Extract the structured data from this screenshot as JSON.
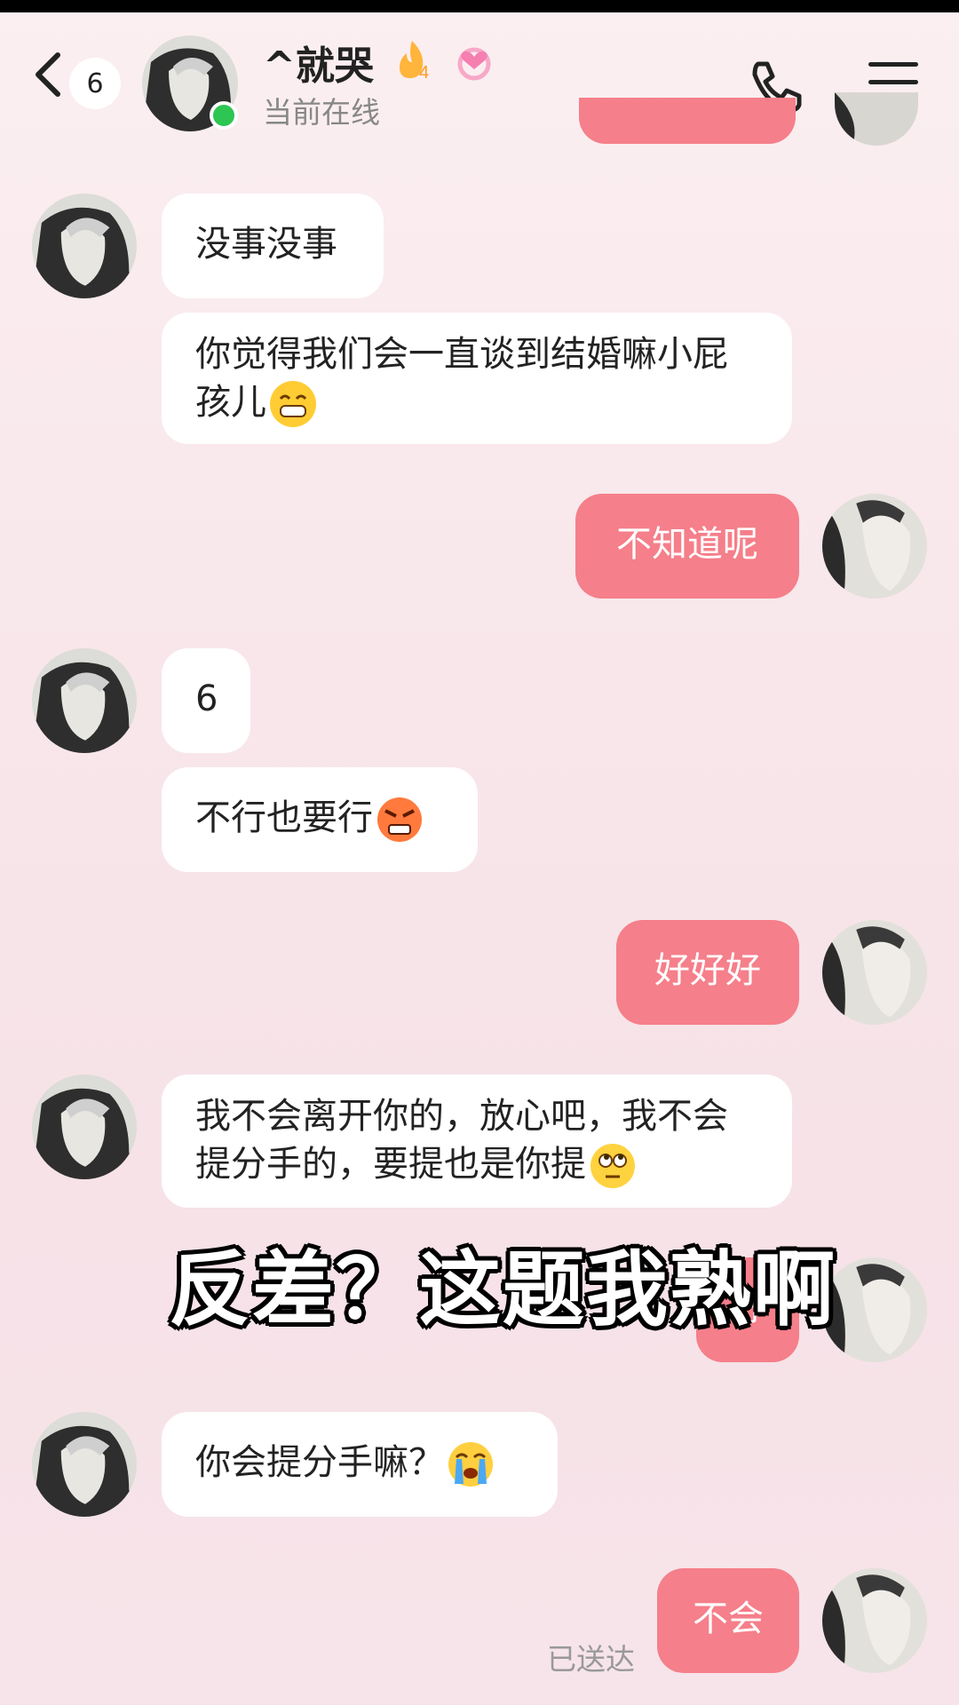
{
  "header": {
    "back_icon": "chevron-left-icon",
    "unread_count": "6",
    "contact_name": "^就哭",
    "fire_badge_level": "4",
    "status": "当前在线",
    "call_icon": "phone-icon",
    "menu_icon": "hamburger-menu-icon"
  },
  "colors": {
    "outgoing_bubble": "#f57f8a",
    "incoming_bubble": "#ffffff",
    "online_dot": "#2dc653"
  },
  "messages": [
    {
      "side": "in",
      "text": "没事没事"
    },
    {
      "side": "in",
      "text": "你觉得我们会一直谈到结婚嘛小屁孩儿",
      "emoji": "grinning-face"
    },
    {
      "side": "out",
      "text": "不知道呢"
    },
    {
      "side": "in",
      "text": "6"
    },
    {
      "side": "in",
      "text": "不行也要行",
      "emoji": "angry-face"
    },
    {
      "side": "out",
      "text": "好好好"
    },
    {
      "side": "in",
      "text": "我不会离开你的，放心吧，我不会提分手的，要提也是你提",
      "emoji": "eye-roll-face"
    },
    {
      "side": "out",
      "text": "好"
    },
    {
      "side": "in",
      "text": "你会提分手嘛？",
      "emoji": "crying-face"
    },
    {
      "side": "out",
      "text": "不会"
    }
  ],
  "delivery_status": "已送达",
  "overlay_caption": "反差？这题我熟啊"
}
